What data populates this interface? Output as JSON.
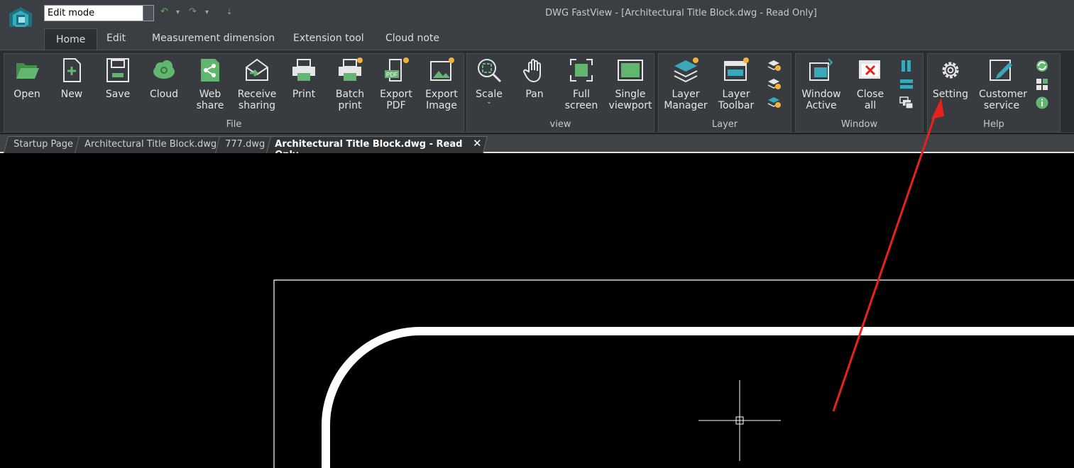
{
  "app": {
    "window_title": "DWG FastView - [Architectural Title Block.dwg - Read Only]",
    "mode_value": "Edit mode"
  },
  "ribbon_tabs": [
    "Home",
    "Edit",
    "Measurement dimension",
    "Extension tool",
    "Cloud note"
  ],
  "groups": {
    "file": {
      "label": "File",
      "buttons": [
        {
          "label": "Open",
          "icon": "folder-open-icon"
        },
        {
          "label": "New",
          "icon": "new-file-icon"
        },
        {
          "label": "Save",
          "icon": "save-disk-icon"
        },
        {
          "label": "Cloud",
          "icon": "cloud-icon"
        },
        {
          "label": "Web\nshare",
          "icon": "share-icon"
        },
        {
          "label": "Receive\nsharing",
          "icon": "receive-envelope-icon"
        },
        {
          "label": "Print",
          "icon": "printer-icon"
        },
        {
          "label": "Batch\nprint",
          "icon": "batch-print-icon"
        },
        {
          "label": "Export\nPDF",
          "icon": "export-pdf-icon"
        },
        {
          "label": "Export\nImage",
          "icon": "export-image-icon"
        }
      ]
    },
    "view": {
      "label": "view",
      "buttons": [
        {
          "label": "Scale",
          "icon": "zoom-icon"
        },
        {
          "label": "Pan",
          "icon": "hand-icon"
        },
        {
          "label": "Full\nscreen",
          "icon": "fullscreen-icon"
        },
        {
          "label": "Single\nviewport",
          "icon": "viewport-icon"
        }
      ]
    },
    "layer": {
      "label": "Layer",
      "buttons": [
        {
          "label": "Layer\nManager",
          "icon": "layers-icon"
        },
        {
          "label": "Layer\nToolbar",
          "icon": "layer-toolbar-icon"
        }
      ]
    },
    "window": {
      "label": "Window",
      "buttons": [
        {
          "label": "Window\nActive",
          "icon": "window-active-icon"
        },
        {
          "label": "Close\nall",
          "icon": "close-all-icon"
        }
      ]
    },
    "help": {
      "label": "Help",
      "buttons": [
        {
          "label": "Setting",
          "icon": "gear-icon"
        },
        {
          "label": "Customer\nservice",
          "icon": "edit-pencil-icon"
        }
      ]
    }
  },
  "document_tabs": [
    "Startup Page",
    "Architectural Title Block.dwg",
    "777.dwg",
    "Architectural Title Block.dwg - Read Only"
  ],
  "colors": {
    "accent_green": "#62b66f",
    "teal": "#3aa8b8",
    "annotation_red": "#e6221c",
    "canvas": "#000000"
  }
}
